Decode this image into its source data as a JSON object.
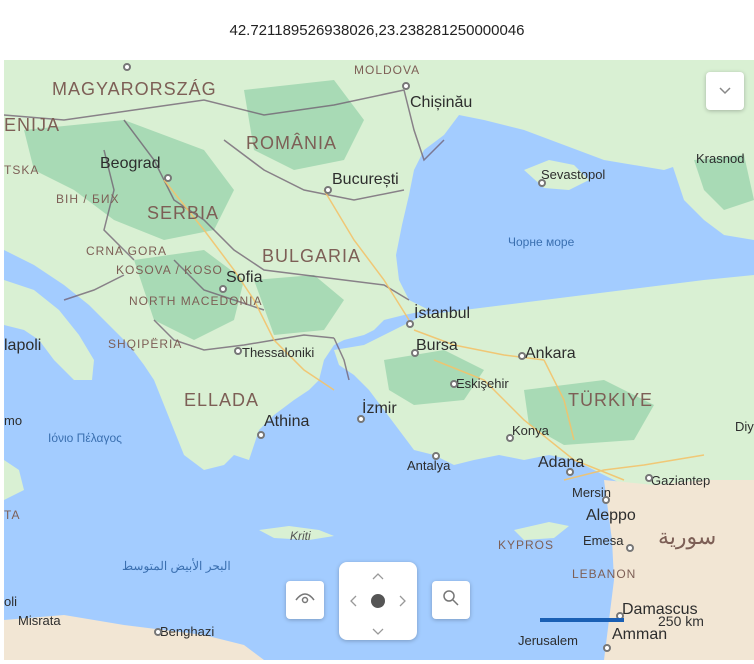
{
  "header": {
    "coordinates": "42.721189526938026,23.238281250000046"
  },
  "map": {
    "labels": {
      "magyarorszag": "MAGYARORSZÁG",
      "moldova": "MOLDOVA",
      "chisinau": "Chișinău",
      "enija": "ENIJA",
      "romania": "ROMÂNIA",
      "krasnod": "Krasnod",
      "tska": "TSKA",
      "beograd": "Beograd",
      "bucuresti": "București",
      "sevastopol": "Sevastopol",
      "bih": "BIH / БИХ",
      "serbia": "SERBIA",
      "black_sea": "Чорне море",
      "crna_gora": "CRNA GORA",
      "bulgaria": "BULGARIA",
      "kosova": "KOSOVA / KOSO",
      "sofia": "Sofia",
      "north_macedonia": "NORTH MACEDONIA",
      "istanbul": "İstanbul",
      "napoli": "lapoli",
      "shqiperia": "SHQIPËRIA",
      "thessaloniki": "Thessaloniki",
      "bursa": "Bursa",
      "ankara": "Ankara",
      "eskisehir": "Eskişehir",
      "ellada": "ELLADA",
      "izmir": "İzmir",
      "turkiye": "TÜRKIYE",
      "mo": "mo",
      "ionian_sea": "Ιόνιο Πέλαγος",
      "athina": "Athina",
      "konya": "Konya",
      "diy": "Diy",
      "antalya": "Antalya",
      "adana": "Adana",
      "gaziantep": "Gaziantep",
      "mersin": "Mersin",
      "ta": "TA",
      "kriti": "Kriti",
      "aleppo": "Aleppo",
      "kypros": "KYPROS",
      "emesa": "Emesa",
      "syria": "سورية",
      "med_sea": "البحر الأبيض المتوسط",
      "lebanon": "LEBANON",
      "oli": "oli",
      "misrata": "Misrata",
      "benghazi": "Benghazi",
      "damascus": "Damascus",
      "jerusalem": "Jerusalem",
      "amman": "Amman"
    },
    "scale": {
      "label": "250 km"
    },
    "controls": {
      "layers_icon": "eye-icon",
      "search_icon": "search-icon",
      "collapse_icon": "chevron-down-icon"
    },
    "colors": {
      "water": "#a3ccff",
      "land": "#d9f0d3",
      "forest": "#a8dab5",
      "desert": "#f2e6d4",
      "border": "#6e5c6f",
      "road": "#f3c36b"
    }
  }
}
